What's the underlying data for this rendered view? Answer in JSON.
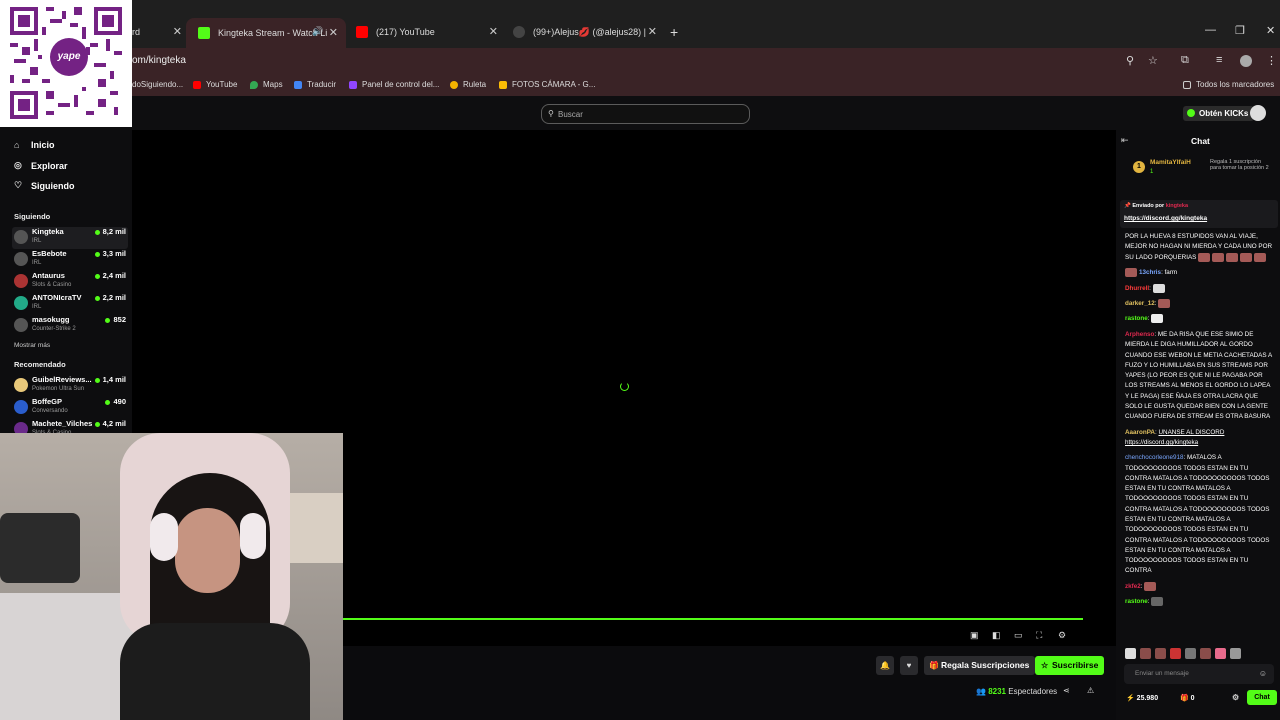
{
  "browser": {
    "tabs": [
      {
        "label": "rd"
      },
      {
        "label": "Kingteka Stream - Watch Li"
      },
      {
        "label": "(217) YouTube"
      },
      {
        "label": "(99+)Alejus💋 (@alejus28) |"
      }
    ],
    "url": "om/kingteka",
    "bookmarks": [
      {
        "label": "doSiguiendo..."
      },
      {
        "label": "YouTube"
      },
      {
        "label": "Maps"
      },
      {
        "label": "Traducir"
      },
      {
        "label": "Panel de control del..."
      },
      {
        "label": "Ruleta"
      },
      {
        "label": "FOTOS CÁMARA - G..."
      }
    ],
    "all_bookmarks": "Todos los marcadores"
  },
  "overlay": {
    "qr_brand": "yape"
  },
  "kick": {
    "search_placeholder": "Buscar",
    "kicks_button": "Obtén KICKs"
  },
  "sidebar": {
    "nav": [
      {
        "label": "Inicio",
        "icon": "home-icon"
      },
      {
        "label": "Explorar",
        "icon": "compass-icon"
      },
      {
        "label": "Siguiendo",
        "icon": "heart-icon"
      }
    ],
    "following_header": "Siguiendo",
    "following": [
      {
        "name": "Kingteka",
        "category": "IRL",
        "viewers": "8,2 mil"
      },
      {
        "name": "EsBebote",
        "category": "IRL",
        "viewers": "3,3 mil"
      },
      {
        "name": "Antaurus",
        "category": "Slots & Casino",
        "viewers": "2,4 mil"
      },
      {
        "name": "ANTONIcraTV",
        "category": "IRL",
        "viewers": "2,2 mil"
      },
      {
        "name": "masokugg",
        "category": "Counter-Strike 2",
        "viewers": "852"
      }
    ],
    "show_more": "Mostrar más",
    "recommended_header": "Recomendado",
    "recommended": [
      {
        "name": "GuibelReviews...",
        "category": "Pokemon Ultra Sun",
        "viewers": "1,4 mil"
      },
      {
        "name": "BoffeGP",
        "category": "Conversando",
        "viewers": "490"
      },
      {
        "name": "Machete_Vilches",
        "category": "Slots & Casino",
        "viewers": "4,2 mil"
      }
    ]
  },
  "player": {
    "progress_pct": 100
  },
  "actions": {
    "gift_label": "Regala Suscripciones",
    "subscribe_label": "Suscribirse",
    "viewers_count": "8231",
    "viewers_label": "Espectadores"
  },
  "chat": {
    "title": "Chat",
    "top_gifter": {
      "rank": "1",
      "name": "MamitaYIfaiH",
      "count": "1",
      "message": "Regala 1 suscripción para tomar la posición 2"
    },
    "pinned": {
      "sent_by_label": "Enviado por",
      "sent_by_user": "kingteka",
      "link": "https://discord.gg/kingteka"
    },
    "messages": [
      {
        "user": "",
        "color": "#ffffff",
        "text": "POR LA HUEVA 8 ESTUPIDOS VAN AL VIAJE, MEJOR NO HAGAN NI MIERDA Y CADA UNO POR SU LADO PORQUERIAS"
      },
      {
        "user": "13chris",
        "color": "#7aa7ff",
        "text": "farm"
      },
      {
        "user": "Dhurrell",
        "color": "#ff3b3b",
        "text": ""
      },
      {
        "user": "darker_12",
        "color": "#e0c060",
        "text": ""
      },
      {
        "user": "rastone",
        "color": "#53fc18",
        "text": ""
      },
      {
        "user": "Arphenso",
        "color": "#e0294f",
        "text": "ME DA RISA QUE ESE SIMIO DE MIERDA LE DIGA HUMILLADOR AL GORDO CUANDO ESE WEBON LE METIA CACHETADAS A FUZO Y LO HUMILLABA EN SUS STREAMS POR YAPES (LO PEOR ES QUE NI LE PAGABA POR LOS STREAMS AL MENOS EL GORDO LO LAPEA Y LE PAGA) ESE ÑAJA ES OTRA LACRA QUE SOLO LE GUSTA QUEDAR BIEN CON LA GENTE CUANDO FUERA DE STREAM ES OTRA BASURA"
      },
      {
        "user": "AaaronPA",
        "color": "#e0c060",
        "text": "UNANSE AL DISCORD https://discord.gg/kingteka"
      },
      {
        "user": "chenchocorleone918",
        "color": "#7aa7ff",
        "text": "MATALOS A TODOOOOOOOOS TODOS ESTAN EN TU CONTRA MATALOS A TODOOOOOOOOS TODOS ESTAN EN TU CONTRA MATALOS A TODOOOOOOOOS TODOS ESTAN EN TU CONTRA MATALOS A TODOOOOOOOOS TODOS ESTAN EN TU CONTRA MATALOS A TODOOOOOOOOS TODOS ESTAN EN TU CONTRA MATALOS A TODOOOOOOOOS TODOS ESTAN EN TU CONTRA MATALOS A TODOOOOOOOOS TODOS ESTAN EN TU CONTRA"
      },
      {
        "user": "zkfe2",
        "color": "#e0294f",
        "text": ""
      },
      {
        "user": "rastone",
        "color": "#53fc18",
        "text": ""
      }
    ],
    "input_placeholder": "Enviar un mensaje",
    "points": "25.980",
    "zero": "0",
    "send_label": "Chat"
  },
  "colors": {
    "kick_green": "#53fc18",
    "tab_active": "#3a2326"
  }
}
